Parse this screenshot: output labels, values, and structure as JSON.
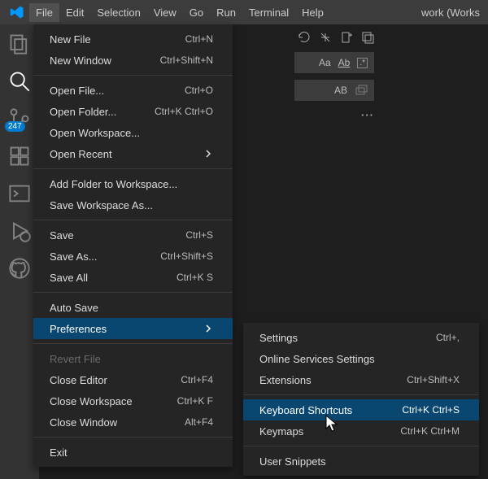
{
  "titlebar": {
    "window_title": "work (Works"
  },
  "menubar": [
    "File",
    "Edit",
    "Selection",
    "View",
    "Go",
    "Run",
    "Terminal",
    "Help"
  ],
  "activitybar": {
    "badge": "247"
  },
  "file_menu": {
    "groups": [
      [
        {
          "label": "New File",
          "shortcut": "Ctrl+N"
        },
        {
          "label": "New Window",
          "shortcut": "Ctrl+Shift+N"
        }
      ],
      [
        {
          "label": "Open File...",
          "shortcut": "Ctrl+O"
        },
        {
          "label": "Open Folder...",
          "shortcut": "Ctrl+K Ctrl+O"
        },
        {
          "label": "Open Workspace..."
        },
        {
          "label": "Open Recent",
          "submenu": true
        }
      ],
      [
        {
          "label": "Add Folder to Workspace..."
        },
        {
          "label": "Save Workspace As..."
        }
      ],
      [
        {
          "label": "Save",
          "shortcut": "Ctrl+S"
        },
        {
          "label": "Save As...",
          "shortcut": "Ctrl+Shift+S"
        },
        {
          "label": "Save All",
          "shortcut": "Ctrl+K S"
        }
      ],
      [
        {
          "label": "Auto Save"
        },
        {
          "label": "Preferences",
          "submenu": true,
          "highlight": true
        }
      ],
      [
        {
          "label": "Revert File",
          "disabled": true
        },
        {
          "label": "Close Editor",
          "shortcut": "Ctrl+F4"
        },
        {
          "label": "Close Workspace",
          "shortcut": "Ctrl+K F"
        },
        {
          "label": "Close Window",
          "shortcut": "Alt+F4"
        }
      ],
      [
        {
          "label": "Exit"
        }
      ]
    ]
  },
  "preferences_submenu": {
    "groups": [
      [
        {
          "label": "Settings",
          "shortcut": "Ctrl+,"
        },
        {
          "label": "Online Services Settings"
        },
        {
          "label": "Extensions",
          "shortcut": "Ctrl+Shift+X"
        }
      ],
      [
        {
          "label": "Keyboard Shortcuts",
          "shortcut": "Ctrl+K Ctrl+S",
          "highlight": true
        },
        {
          "label": "Keymaps",
          "shortcut": "Ctrl+K Ctrl+M"
        }
      ],
      [
        {
          "label": "User Snippets"
        }
      ]
    ]
  },
  "search_opts": {
    "aa": "Aa",
    "ab": "Ab",
    "re": ".*",
    "ab2": "AB"
  }
}
